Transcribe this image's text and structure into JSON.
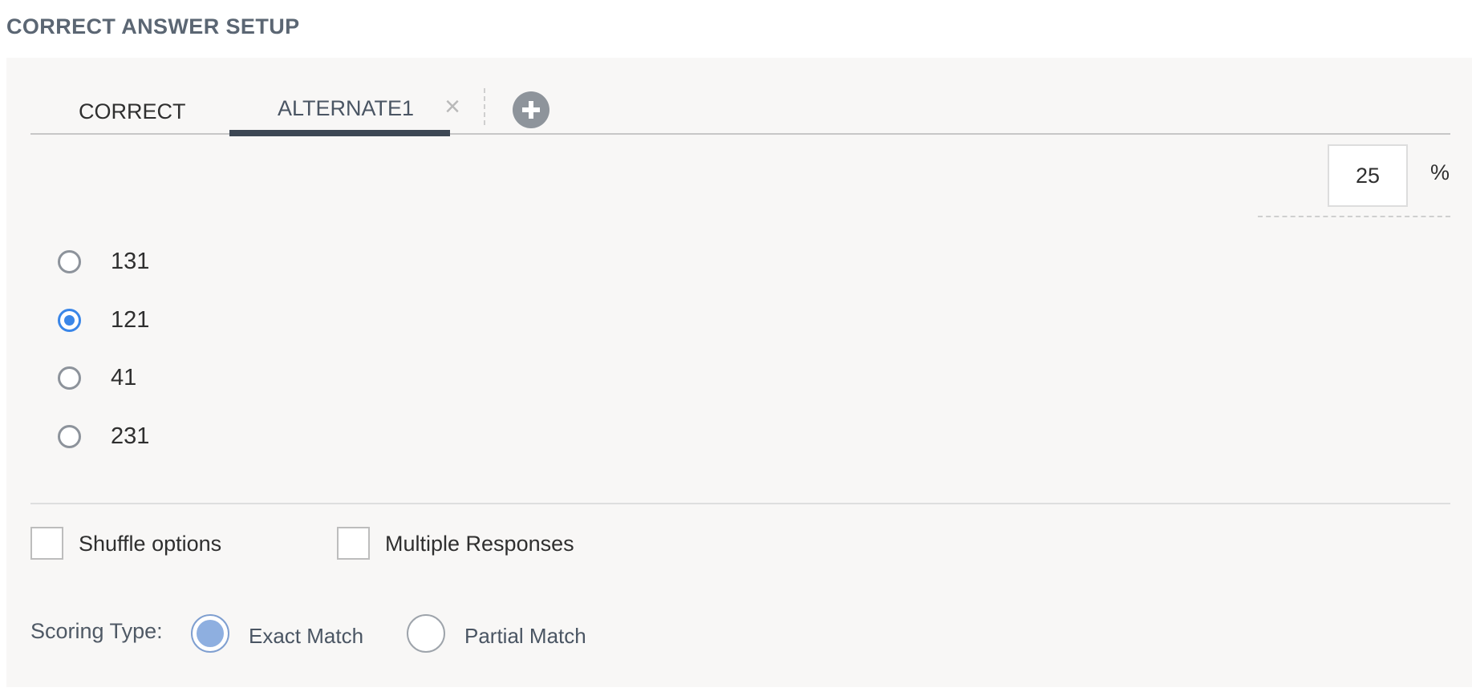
{
  "header": {
    "title": "CORRECT ANSWER SETUP"
  },
  "tabs": [
    {
      "label": "CORRECT",
      "active": false
    },
    {
      "label": "ALTERNATE1",
      "active": true,
      "close_icon": "close-icon"
    }
  ],
  "tab_actions": {
    "add_icon": "plus-circle-icon"
  },
  "score": {
    "percent_value": "25",
    "unit": "%"
  },
  "options": [
    {
      "label": "131",
      "selected": false
    },
    {
      "label": "121",
      "selected": true
    },
    {
      "label": "41",
      "selected": false
    },
    {
      "label": "231",
      "selected": false
    }
  ],
  "settings": {
    "shuffle_label": "Shuffle options",
    "multiple_label": "Multiple Responses"
  },
  "scoring": {
    "label": "Scoring Type:",
    "options": [
      {
        "label": "Exact Match",
        "selected": true
      },
      {
        "label": "Partial Match",
        "selected": false
      }
    ]
  },
  "colors": {
    "accent": "#3a86e8",
    "active_tab": "#3d4754",
    "panel_background": "#f8f7f6"
  }
}
